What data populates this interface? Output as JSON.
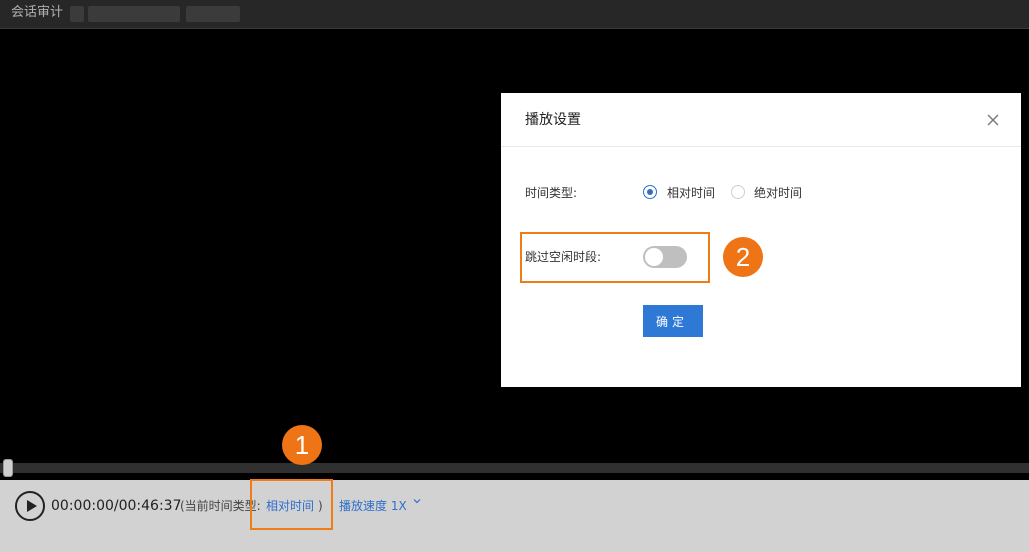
{
  "window": {
    "title": "会话审计"
  },
  "player": {
    "time_display": "00:00:00/00:46:37",
    "time_type_label": "(当前时间类型:",
    "time_type_value": "相对时间",
    "close_paren": ")",
    "speed_label": "播放速度 1X",
    "progress": 0
  },
  "modal": {
    "title": "播放设置",
    "time_type_label": "时间类型:",
    "options": [
      {
        "label": "相对时间",
        "checked": true
      },
      {
        "label": "绝对时间",
        "checked": false
      }
    ],
    "skip_idle_label": "跳过空闲时段:",
    "skip_idle_enabled": false,
    "confirm_label": "确定"
  },
  "annotations": [
    {
      "label": "1"
    },
    {
      "label": "2"
    }
  ],
  "colors": {
    "accent": "#2e78d6",
    "annotation": "#ef7416"
  }
}
